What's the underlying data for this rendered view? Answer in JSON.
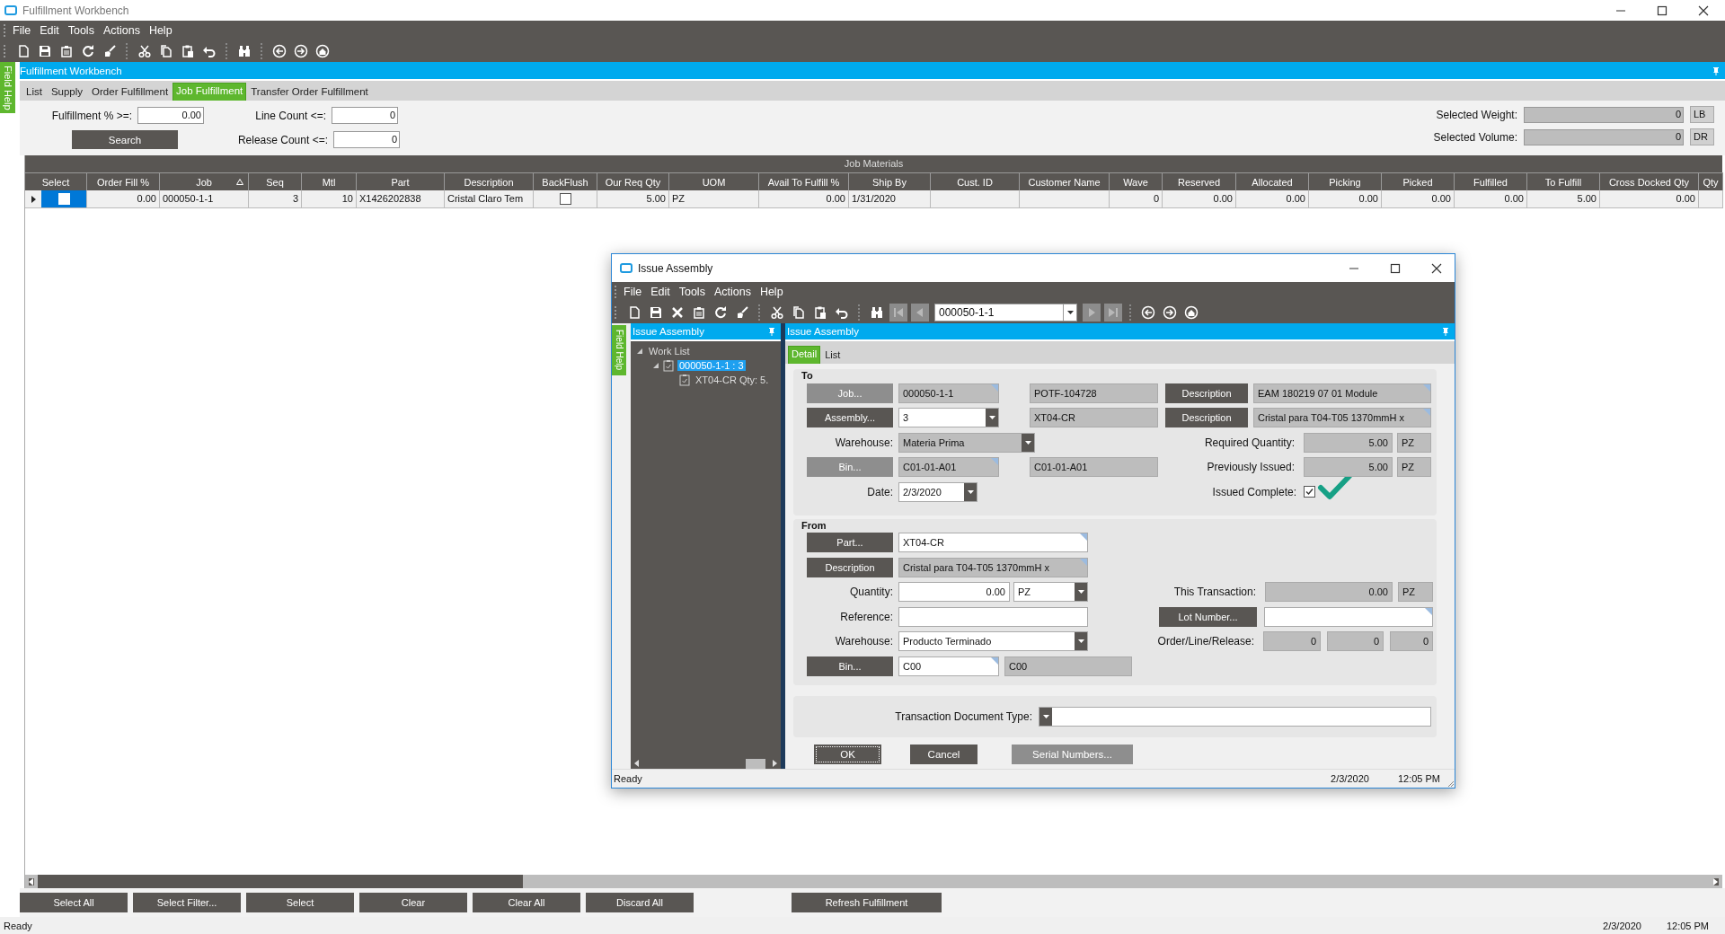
{
  "window": {
    "title": "Fulfillment Workbench"
  },
  "menu": [
    "File",
    "Edit",
    "Tools",
    "Actions",
    "Help"
  ],
  "side_tab": "Field Help",
  "panel_title": "Fulfillment Workbench",
  "tabs": [
    {
      "label": "List",
      "selected": false
    },
    {
      "label": "Supply",
      "selected": false
    },
    {
      "label": "Order Fulfillment",
      "selected": false
    },
    {
      "label": "Job Fulfillment",
      "selected": true
    },
    {
      "label": "Transfer Order Fulfillment",
      "selected": false
    }
  ],
  "filters": [
    {
      "label": "Fulfillment % >=:",
      "value": "0.00"
    },
    {
      "label": "Line Count <=:",
      "value": "0"
    },
    {
      "label": "Release Count <=:",
      "value": "0"
    }
  ],
  "search_button": "Search",
  "totals": [
    {
      "label": "Selected Weight:",
      "value": "0",
      "unit": "LB"
    },
    {
      "label": "Selected Volume:",
      "value": "0",
      "unit": "DR"
    }
  ],
  "grid": {
    "title": "Job Materials",
    "columns": [
      {
        "label": "Select",
        "kind": "check",
        "sorted": false
      },
      {
        "label": "Order Fill %",
        "kind": "number",
        "sorted": false
      },
      {
        "label": "Job",
        "kind": "text",
        "sorted": true
      },
      {
        "label": "Seq",
        "kind": "number",
        "sorted": false
      },
      {
        "label": "Mtl",
        "kind": "number",
        "sorted": false
      },
      {
        "label": "Part",
        "kind": "text",
        "sorted": false
      },
      {
        "label": "Description",
        "kind": "text",
        "sorted": false
      },
      {
        "label": "BackFlush",
        "kind": "check",
        "sorted": false
      },
      {
        "label": "Our Req Qty",
        "kind": "number",
        "sorted": false
      },
      {
        "label": "UOM",
        "kind": "text",
        "sorted": false
      },
      {
        "label": "Avail To Fulfill %",
        "kind": "number",
        "sorted": false
      },
      {
        "label": "Ship By",
        "kind": "text",
        "sorted": false
      },
      {
        "label": "Cust. ID",
        "kind": "text",
        "sorted": false
      },
      {
        "label": "Customer Name",
        "kind": "text",
        "sorted": false
      },
      {
        "label": "Wave",
        "kind": "number",
        "sorted": false
      },
      {
        "label": "Reserved",
        "kind": "number",
        "sorted": false
      },
      {
        "label": "Allocated",
        "kind": "number",
        "sorted": false
      },
      {
        "label": "Picking",
        "kind": "number",
        "sorted": false
      },
      {
        "label": "Picked",
        "kind": "number",
        "sorted": false
      },
      {
        "label": "Fulfilled",
        "kind": "number",
        "sorted": false
      },
      {
        "label": "To Fulfill",
        "kind": "number",
        "sorted": false
      },
      {
        "label": "Cross Docked Qty",
        "kind": "number",
        "sorted": false
      },
      {
        "label": "Qty",
        "kind": "number",
        "sorted": false
      }
    ],
    "rows": [
      {
        "selected": true,
        "cells": [
          false,
          "0.00",
          "000050-1-1",
          "3",
          "10",
          "X1426202838",
          "Cristal Claro Tem",
          false,
          "5.00",
          "PZ",
          "0.00",
          "1/31/2020",
          null,
          null,
          "0",
          "0.00",
          "0.00",
          "0.00",
          "0.00",
          "0.00",
          "5.00",
          "0.00",
          null
        ]
      }
    ]
  },
  "buttons": [
    "Select All",
    "Select Filter...",
    "Select",
    "Clear",
    "Clear All",
    "Discard All"
  ],
  "refresh_button": "Refresh Fulfillment",
  "status_bar": {
    "text": "Ready",
    "date": "2/3/2020",
    "time": "12:05 PM"
  },
  "dialog": {
    "title": "Issue Assembly",
    "menu": [
      "File",
      "Edit",
      "Tools",
      "Actions",
      "Help"
    ],
    "record": "000050-1-1",
    "side_tab": "Field Help",
    "tree": {
      "title": "Issue Assembly",
      "items": [
        {
          "label": "Work List",
          "expanded": true,
          "selected": false,
          "children": [
            {
              "label": "000050-1-1 : 3",
              "expanded": true,
              "selected": true,
              "children": [
                {
                  "label": "XT04-CR Qty: 5.",
                  "selected": false
                }
              ]
            }
          ]
        }
      ]
    },
    "panel_title": "Issue Assembly",
    "tabs": [
      {
        "label": "Detail",
        "selected": true
      },
      {
        "label": "List",
        "selected": false
      }
    ],
    "groups": [
      {
        "title": "To",
        "rows": [
          {
            "left": [
              {
                "kind": "button",
                "label": "Job...",
                "disabled": true
              },
              {
                "kind": "field",
                "value": "000050-1-1",
                "editable": false,
                "linked": true,
                "numeric": false
              },
              {
                "kind": "field",
                "value": "POTF-104728",
                "editable": false,
                "linked": false,
                "numeric": false
              }
            ],
            "right": [
              {
                "kind": "button",
                "label": "Description",
                "disabled": false
              },
              {
                "kind": "field",
                "value": "EAM 180219 07 01 Module",
                "editable": false,
                "linked": true,
                "numeric": false
              }
            ]
          },
          {
            "left": [
              {
                "kind": "button",
                "label": "Assembly...",
                "disabled": false
              },
              {
                "kind": "combo",
                "value": "3",
                "editable": true
              },
              {
                "kind": "field",
                "value": "XT04-CR",
                "editable": false,
                "linked": false,
                "numeric": false
              }
            ],
            "right": [
              {
                "kind": "button",
                "label": "Description",
                "disabled": false
              },
              {
                "kind": "field",
                "value": "Cristal para T04-T05 1370mmH x",
                "editable": false,
                "linked": true,
                "numeric": false
              }
            ]
          },
          {
            "left": [
              {
                "kind": "label",
                "label": "Warehouse:"
              },
              {
                "kind": "combo",
                "value": "Materia Prima",
                "editable": false
              }
            ],
            "right": [
              {
                "kind": "label",
                "label": "Required Quantity:"
              },
              {
                "kind": "field",
                "value": "5.00",
                "editable": false,
                "linked": false,
                "numeric": true
              },
              {
                "kind": "field",
                "value": "PZ",
                "editable": false,
                "linked": false,
                "numeric": false
              }
            ]
          },
          {
            "left": [
              {
                "kind": "button",
                "label": "Bin...",
                "disabled": true
              },
              {
                "kind": "field",
                "value": "C01-01-A01",
                "editable": false,
                "linked": true,
                "numeric": false
              },
              {
                "kind": "field",
                "value": "C01-01-A01",
                "editable": false,
                "linked": false,
                "numeric": false
              }
            ],
            "right": [
              {
                "kind": "label",
                "label": "Previously Issued:"
              },
              {
                "kind": "field",
                "value": "5.00",
                "editable": false,
                "linked": false,
                "numeric": true
              },
              {
                "kind": "field",
                "value": "PZ",
                "editable": false,
                "linked": false,
                "numeric": false
              }
            ]
          },
          {
            "left": [
              {
                "kind": "label",
                "label": "Date:"
              },
              {
                "kind": "combo",
                "value": "2/3/2020",
                "editable": true
              }
            ],
            "right": [
              {
                "kind": "label",
                "label": "Issued Complete:"
              },
              {
                "kind": "check",
                "checked": true
              },
              {
                "kind": "tick_mark"
              }
            ]
          }
        ]
      },
      {
        "title": "From",
        "rows": [
          {
            "left": [
              {
                "kind": "button",
                "label": "Part...",
                "disabled": false
              },
              {
                "kind": "field",
                "value": "XT04-CR",
                "editable": true,
                "linked": true,
                "numeric": false
              }
            ]
          },
          {
            "left": [
              {
                "kind": "button",
                "label": "Description",
                "disabled": false
              },
              {
                "kind": "field",
                "value": "Cristal para T04-T05 1370mmH x",
                "editable": false,
                "linked": true,
                "numeric": false
              }
            ]
          },
          {
            "left": [
              {
                "kind": "label",
                "label": "Quantity:"
              },
              {
                "kind": "field",
                "value": "0.00",
                "editable": true,
                "linked": false,
                "numeric": true
              },
              {
                "kind": "combo",
                "value": "PZ",
                "editable": true
              }
            ],
            "right": [
              {
                "kind": "label",
                "label": "This Transaction:"
              },
              {
                "kind": "field",
                "value": "0.00",
                "editable": false,
                "linked": false,
                "numeric": true
              },
              {
                "kind": "field",
                "value": "PZ",
                "editable": false,
                "linked": false,
                "numeric": false
              }
            ]
          },
          {
            "left": [
              {
                "kind": "label",
                "label": "Reference:"
              },
              {
                "kind": "field",
                "editable": true,
                "linked": false
              }
            ],
            "right": [
              {
                "kind": "button",
                "label": "Lot Number...",
                "disabled": false
              },
              {
                "kind": "field",
                "editable": true,
                "linked": true
              }
            ]
          },
          {
            "left": [
              {
                "kind": "label",
                "label": "Warehouse:"
              },
              {
                "kind": "combo",
                "value": "Producto Terminado",
                "editable": true
              }
            ],
            "right": [
              {
                "kind": "label",
                "label": "Order/Line/Release:"
              },
              {
                "kind": "field",
                "value": "0",
                "editable": false,
                "linked": false,
                "numeric": true
              },
              {
                "kind": "field",
                "value": "0",
                "editable": false,
                "linked": false,
                "numeric": true
              },
              {
                "kind": "field",
                "value": "0",
                "editable": false,
                "linked": false,
                "numeric": true
              }
            ]
          },
          {
            "left": [
              {
                "kind": "button",
                "label": "Bin...",
                "disabled": false
              },
              {
                "kind": "field",
                "value": "C00",
                "editable": true,
                "linked": true,
                "numeric": false
              },
              {
                "kind": "field",
                "value": "C00",
                "editable": false,
                "linked": false,
                "numeric": false
              }
            ]
          }
        ]
      },
      {
        "rows": [
          {
            "right": [
              {
                "kind": "label",
                "label": "Transaction Document Type:"
              },
              {
                "kind": "combo",
                "editable": true
              }
            ]
          }
        ]
      }
    ],
    "buttons": [
      {
        "label": "OK",
        "disabled": false,
        "focused": true
      },
      {
        "label": "Cancel",
        "disabled": false,
        "focused": false
      },
      {
        "label": "Serial Numbers...",
        "disabled": true,
        "focused": false
      }
    ],
    "status_bar": {
      "text": "Ready",
      "date": "2/3/2020",
      "time": "12:05 PM"
    }
  }
}
